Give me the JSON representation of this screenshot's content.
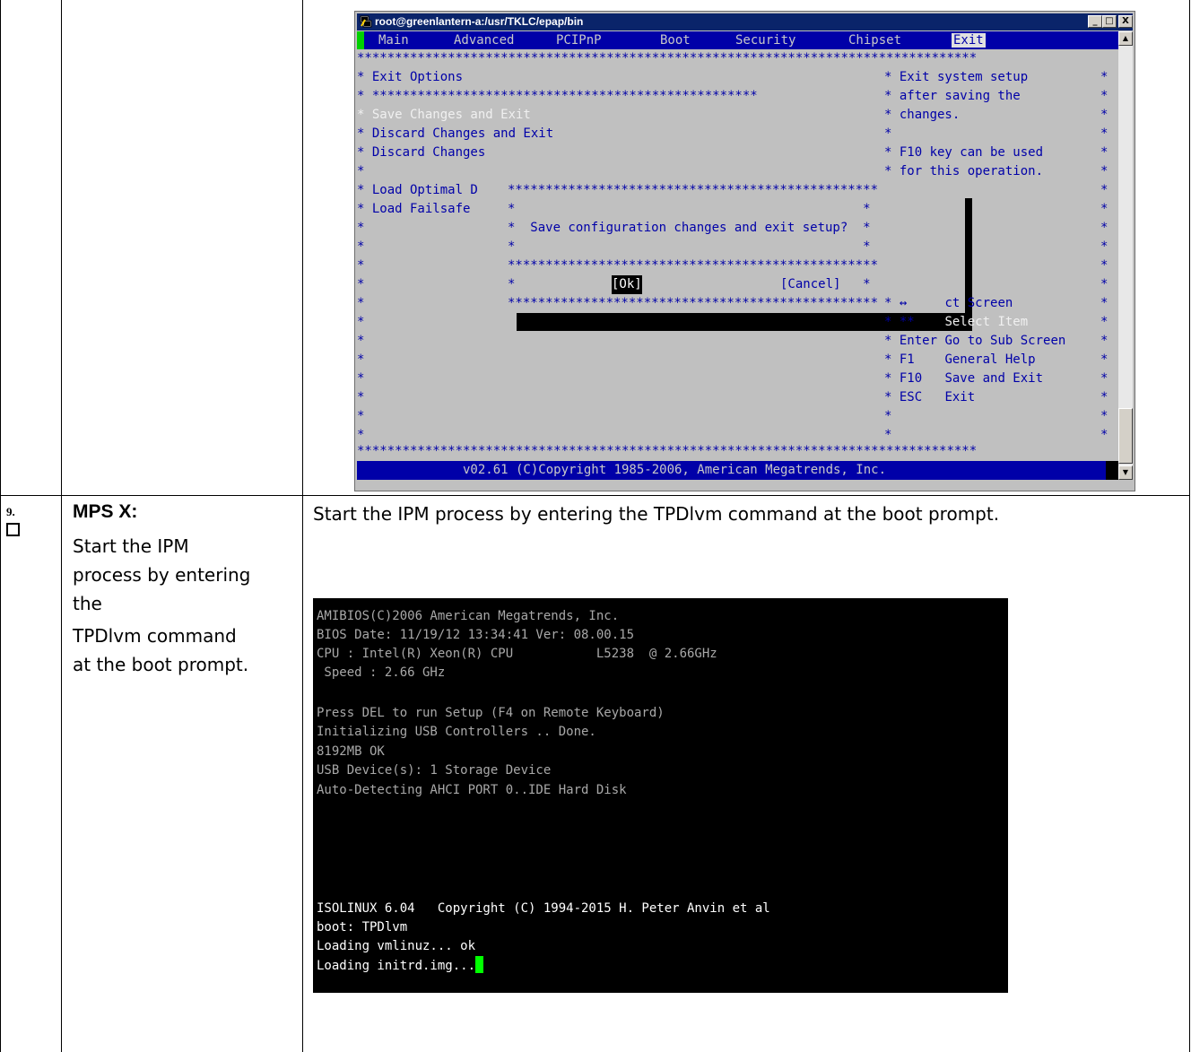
{
  "bios": {
    "title": "root@greenlantern-a:/usr/TKLC/epap/bin",
    "window_buttons": [
      "_",
      "□",
      "X"
    ],
    "menu_tabs": [
      "Main",
      "Advanced",
      "PCIPnP",
      "Boot",
      "Security",
      "Chipset",
      "Exit"
    ],
    "active_tab": "Exit",
    "border_line": "**********************************************************************************",
    "left_header": "* Exit Options",
    "left_sub": "* ***************************************************",
    "options": [
      "* Save Changes and Exit",
      "* Discard Changes and Exit",
      "* Discard Changes",
      "*",
      "* Load Optimal D",
      "* Load Failsafe"
    ],
    "help_right": [
      "* Exit system setup",
      "* after saving the",
      "* changes.",
      "*",
      "* F10 key can be used",
      "* for this operation."
    ],
    "dialog_border": "*************************************************",
    "dialog_message": "*  Save configuration changes and exit setup?  *",
    "dialog_ok": "[Ok]",
    "dialog_cancel": "[Cancel]",
    "keys": [
      {
        "key": "* ↔",
        "action": "ct Screen"
      },
      {
        "key": "* **",
        "action": "Select Item"
      },
      {
        "key": "* Enter",
        "action": "Go to Sub Screen"
      },
      {
        "key": "* F1",
        "action": "General Help"
      },
      {
        "key": "* F10",
        "action": "Save and Exit"
      },
      {
        "key": "* ESC",
        "action": "Exit"
      }
    ],
    "status_bar": "v02.61 (C)Copyright 1985-2006, American Megatrends, Inc."
  },
  "step": {
    "number": "9.",
    "title": "MPS X:",
    "description_lines": [
      "Start the IPM",
      "process by entering",
      "the",
      "TPDlvm command",
      "at the boot prompt."
    ],
    "instruction": "Start the IPM process by entering the TPDlvm command at the boot prompt."
  },
  "boot_console": {
    "lines": [
      "AMIBIOS(C)2006 American Megatrends, Inc.",
      "BIOS Date: 11/19/12 13:34:41 Ver: 08.00.15",
      "CPU : Intel(R) Xeon(R) CPU           L5238  @ 2.66GHz",
      " Speed : 2.66 GHz",
      "",
      "Press DEL to run Setup (F4 on Remote Keyboard)",
      "Initializing USB Controllers .. Done.",
      "8192MB OK",
      "USB Device(s): 1 Storage Device",
      "Auto-Detecting AHCI PORT 0..IDE Hard Disk"
    ],
    "isolinux": "ISOLINUX 6.04   Copyright (C) 1994-2015 H. Peter Anvin et al",
    "boot_prompt": "boot: TPDlvm",
    "loading_vmlinuz": "Loading vmlinuz... ok",
    "loading_initrd": "Loading initrd.img..."
  },
  "colors": {
    "bios_blue": "#0000a8",
    "bios_gray": "#c0c0c0",
    "cursor_green": "#00ff00"
  }
}
